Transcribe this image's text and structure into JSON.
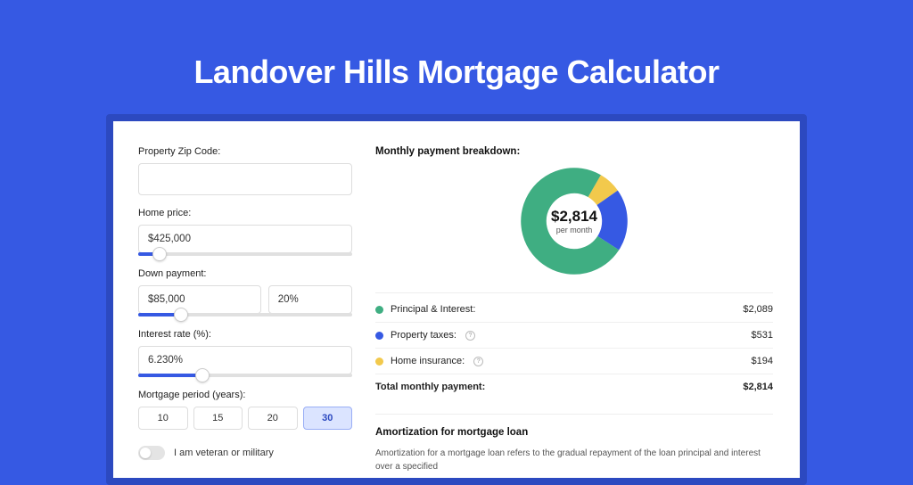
{
  "page_title": "Landover Hills Mortgage Calculator",
  "form": {
    "zip_label": "Property Zip Code:",
    "zip_value": "",
    "home_price_label": "Home price:",
    "home_price_value": "$425,000",
    "home_price_slider_pct": 10,
    "down_payment_label": "Down payment:",
    "down_payment_value": "$85,000",
    "down_payment_pct_value": "20%",
    "down_payment_slider_pct": 20,
    "interest_label": "Interest rate (%):",
    "interest_value": "6.230%",
    "interest_slider_pct": 30,
    "period_label": "Mortgage period (years):",
    "period_options": [
      "10",
      "15",
      "20",
      "30"
    ],
    "period_selected": "30",
    "veteran_label": "I am veteran or military"
  },
  "breakdown": {
    "title": "Monthly payment breakdown:",
    "total_value": "$2,814",
    "per_month": "per month",
    "items": [
      {
        "label": "Principal & Interest:",
        "value": "$2,089",
        "color": "#3fae82"
      },
      {
        "label": "Property taxes:",
        "value": "$531",
        "color": "#3659e3",
        "info": true
      },
      {
        "label": "Home insurance:",
        "value": "$194",
        "color": "#f2c94c",
        "info": true
      }
    ],
    "total_label": "Total monthly payment:"
  },
  "amort": {
    "title": "Amortization for mortgage loan",
    "text": "Amortization for a mortgage loan refers to the gradual repayment of the loan principal and interest over a specified"
  },
  "chart_data": {
    "type": "pie",
    "title": "Monthly payment breakdown",
    "series": [
      {
        "name": "Principal & Interest",
        "value": 2089,
        "color": "#3fae82"
      },
      {
        "name": "Property taxes",
        "value": 531,
        "color": "#3659e3"
      },
      {
        "name": "Home insurance",
        "value": 194,
        "color": "#f2c94c"
      }
    ],
    "total": 2814,
    "center_label": "$2,814 per month"
  }
}
